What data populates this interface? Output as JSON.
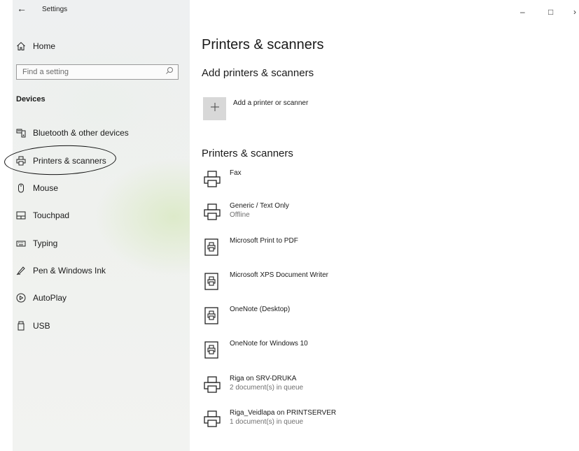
{
  "window": {
    "title": "Settings",
    "back_icon": "arrow-left-icon",
    "controls": {
      "minimize": "–",
      "maximize": "□",
      "close": "›"
    }
  },
  "sidebar": {
    "home_label": "Home",
    "search_placeholder": "Find a setting",
    "section_heading": "Devices",
    "items": [
      {
        "label": "Bluetooth & other devices",
        "icon": "bluetooth-devices-icon"
      },
      {
        "label": "Printers & scanners",
        "icon": "printer-icon"
      },
      {
        "label": "Mouse",
        "icon": "mouse-icon"
      },
      {
        "label": "Touchpad",
        "icon": "touchpad-icon"
      },
      {
        "label": "Typing",
        "icon": "keyboard-icon"
      },
      {
        "label": "Pen & Windows Ink",
        "icon": "pen-icon"
      },
      {
        "label": "AutoPlay",
        "icon": "autoplay-icon"
      },
      {
        "label": "USB",
        "icon": "usb-icon"
      }
    ]
  },
  "main": {
    "page_title": "Printers & scanners",
    "add_heading": "Add printers & scanners",
    "add_button_label": "Add a printer or scanner",
    "list_heading": "Printers & scanners",
    "printers": [
      {
        "name": "Fax",
        "status": "",
        "icon": "printer-icon"
      },
      {
        "name": "Generic / Text Only",
        "status": "Offline",
        "icon": "printer-icon"
      },
      {
        "name": "Microsoft Print to PDF",
        "status": "",
        "icon": "document-printer-icon"
      },
      {
        "name": "Microsoft XPS Document Writer",
        "status": "",
        "icon": "document-printer-icon"
      },
      {
        "name": "OneNote (Desktop)",
        "status": "",
        "icon": "document-printer-icon"
      },
      {
        "name": "OneNote for Windows 10",
        "status": "",
        "icon": "document-printer-icon"
      },
      {
        "name": "Riga on SRV-DRUKA",
        "status": "2 document(s) in queue",
        "icon": "printer-icon"
      },
      {
        "name": "Riga_Veidlapa on PRINTSERVER",
        "status": "1 document(s) in queue",
        "icon": "printer-icon"
      }
    ]
  },
  "annotation": {
    "type": "hand-drawn-circle",
    "target": "Printers & scanners"
  }
}
